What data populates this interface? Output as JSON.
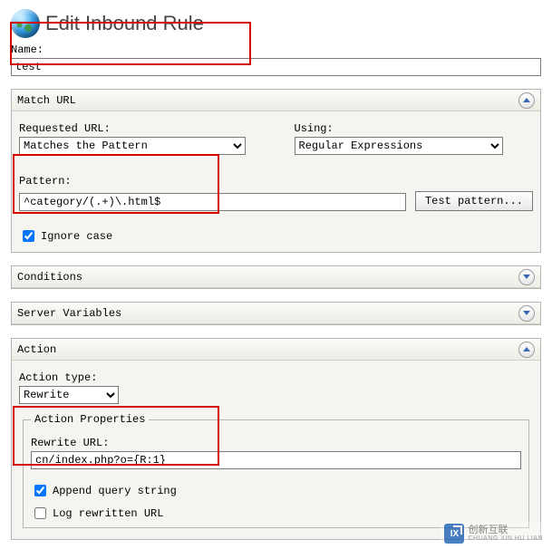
{
  "title": "Edit Inbound Rule",
  "name": {
    "label": "Name:",
    "value": "test"
  },
  "match_url": {
    "header": "Match URL",
    "requested_label": "Requested URL:",
    "requested_value": "Matches the Pattern",
    "using_label": "Using:",
    "using_value": "Regular Expressions",
    "pattern_label": "Pattern:",
    "pattern_value": "^category/(.+)\\.html$",
    "test_btn": "Test pattern...",
    "ignore_case_label": "Ignore case",
    "ignore_case_checked": true
  },
  "conditions": {
    "header": "Conditions"
  },
  "server_vars": {
    "header": "Server Variables"
  },
  "action": {
    "header": "Action",
    "type_label": "Action type:",
    "type_value": "Rewrite",
    "properties_legend": "Action Properties",
    "rewrite_url_label": "Rewrite URL:",
    "rewrite_url_value": "cn/index.php?o={R:1}",
    "append_qs_label": "Append query string",
    "append_qs_checked": true,
    "log_rewritten_label": "Log rewritten URL",
    "log_rewritten_checked": false
  },
  "watermark": {
    "logo": "IX",
    "line1": "创新互联",
    "line2": "CHUANG XIN HU LIAN"
  }
}
